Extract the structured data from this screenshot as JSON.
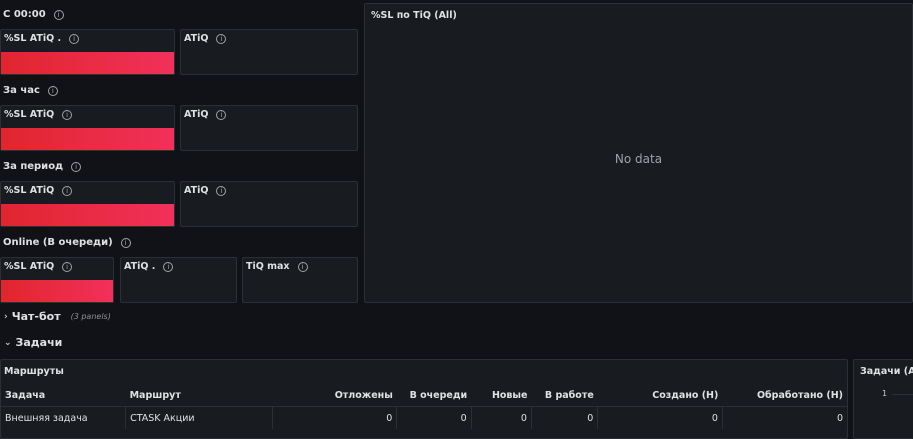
{
  "rows": {
    "since_midnight": "С 00:00",
    "per_hour": "За час",
    "per_period": "За период",
    "online": "Online (В очереди)"
  },
  "stat_panels": {
    "sl_atiq_dot": "%SL ATiQ .",
    "sl_atiq": "%SL ATiQ",
    "atiq": "ATiQ",
    "atiq_dot": "ATiQ .",
    "tiq_max": "TiQ max"
  },
  "big_panel": {
    "title": "%SL по TiQ (All)",
    "empty": "No data"
  },
  "chatbot": {
    "title": "Чат-бот",
    "subtitle": "(3 panels)"
  },
  "tasks": {
    "title": "Задачи"
  },
  "routes_panel": {
    "title": "Маршруты",
    "columns": [
      "Задача",
      "Маршрут",
      "Отложены",
      "В очереди",
      "Новые",
      "В работе",
      "Создано (Н)",
      "Обработано (Н)"
    ],
    "rows": [
      [
        "Внешняя задача",
        "CTASK Акции",
        "0",
        "0",
        "0",
        "0",
        "0",
        "0"
      ]
    ]
  },
  "tasks_panel": {
    "title": "Задачи (All)",
    "axis_label": "1"
  },
  "colors": {
    "background": "#111217",
    "panel": "#181b1f",
    "bar_start": "#e0262e",
    "bar_end": "#f2305a"
  }
}
